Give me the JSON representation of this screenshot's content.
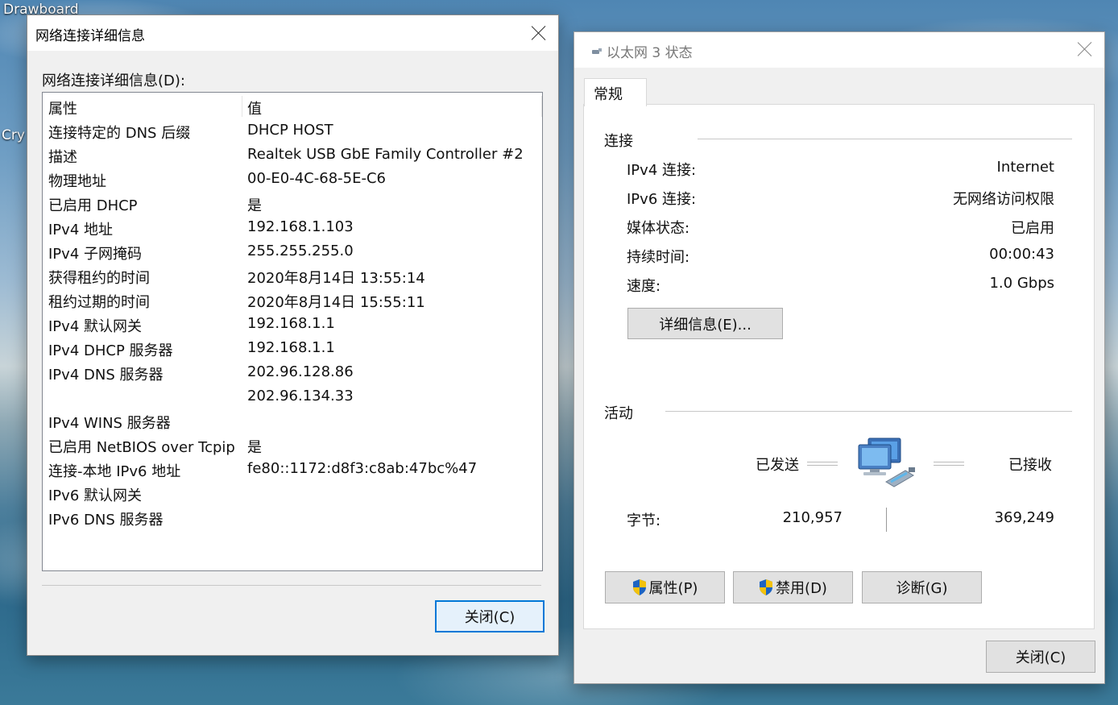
{
  "desktop": {
    "label_top": "Drawboard",
    "label_side": "Cry"
  },
  "details_dialog": {
    "title": "网络连接详细信息",
    "list_label": "网络连接详细信息(D):",
    "col_property": "属性",
    "col_value": "值",
    "rows": [
      {
        "property": "连接特定的 DNS 后缀",
        "value": "DHCP HOST"
      },
      {
        "property": "描述",
        "value": "Realtek USB GbE Family Controller #2"
      },
      {
        "property": "物理地址",
        "value": "00-E0-4C-68-5E-C6"
      },
      {
        "property": "已启用 DHCP",
        "value": "是"
      },
      {
        "property": "IPv4 地址",
        "value": "192.168.1.103"
      },
      {
        "property": "IPv4 子网掩码",
        "value": "255.255.255.0"
      },
      {
        "property": "获得租约的时间",
        "value": "2020年8月14日 13:55:14"
      },
      {
        "property": "租约过期的时间",
        "value": "2020年8月14日 15:55:11"
      },
      {
        "property": "IPv4 默认网关",
        "value": "192.168.1.1"
      },
      {
        "property": "IPv4 DHCP 服务器",
        "value": "192.168.1.1"
      },
      {
        "property": "IPv4 DNS 服务器",
        "value": "202.96.128.86"
      },
      {
        "property": "",
        "value": "202.96.134.33"
      },
      {
        "property": "IPv4 WINS 服务器",
        "value": ""
      },
      {
        "property": "已启用 NetBIOS over Tcpip",
        "value": "是"
      },
      {
        "property": "连接-本地 IPv6 地址",
        "value": "fe80::1172:d8f3:c8ab:47bc%47"
      },
      {
        "property": "IPv6 默认网关",
        "value": ""
      },
      {
        "property": "IPv6 DNS 服务器",
        "value": ""
      }
    ],
    "close_button": "关闭(C)"
  },
  "status_dialog": {
    "title": "以太网 3 状态",
    "tab_general": "常规",
    "connection_heading": "连接",
    "connection_rows": [
      {
        "label": "IPv4 连接:",
        "value": "Internet"
      },
      {
        "label": "IPv6 连接:",
        "value": "无网络访问权限"
      },
      {
        "label": "媒体状态:",
        "value": "已启用"
      },
      {
        "label": "持续时间:",
        "value": "00:00:43"
      },
      {
        "label": "速度:",
        "value": "1.0 Gbps"
      }
    ],
    "details_button": "详细信息(E)...",
    "activity_heading": "活动",
    "sent_label": "已发送",
    "received_label": "已接收",
    "bytes_label": "字节:",
    "bytes_sent": "210,957",
    "bytes_received": "369,249",
    "properties_button": "属性(P)",
    "disable_button": "禁用(D)",
    "diagnose_button": "诊断(G)",
    "close_button": "关闭(C)"
  }
}
